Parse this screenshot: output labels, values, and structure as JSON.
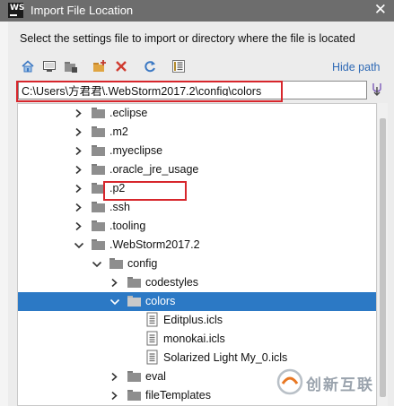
{
  "window": {
    "title": "Import File Location",
    "app_icon_text": "WS",
    "close_glyph": "✕"
  },
  "description": "Select the settings file to import or directory where the file is located",
  "toolbar": {
    "buttons": [
      "home-icon",
      "desktop-icon",
      "project-folder-icon",
      "new-folder-icon",
      "delete-icon",
      "refresh-icon",
      "show-hidden-icon"
    ],
    "hide_path_label": "Hide path"
  },
  "path": {
    "value": "C:\\Users\\方君君\\.WebStorm2017.2\\config\\colors"
  },
  "tree": {
    "rows": [
      {
        "label": ".eclipse",
        "kind": "folder",
        "arrow": "collapsed"
      },
      {
        "label": ".m2",
        "kind": "folder",
        "arrow": "collapsed"
      },
      {
        "label": ".myeclipse",
        "kind": "folder",
        "arrow": "collapsed"
      },
      {
        "label": ".oracle_jre_usage",
        "kind": "folder",
        "arrow": "collapsed"
      },
      {
        "label": ".p2",
        "kind": "folder",
        "arrow": "collapsed"
      },
      {
        "label": ".ssh",
        "kind": "folder",
        "arrow": "collapsed"
      },
      {
        "label": ".tooling",
        "kind": "folder",
        "arrow": "collapsed"
      },
      {
        "label": ".WebStorm2017.2",
        "kind": "folder",
        "arrow": "expanded"
      },
      {
        "label": "config",
        "kind": "folder",
        "arrow": "expanded"
      },
      {
        "label": "codestyles",
        "kind": "folder",
        "arrow": "collapsed"
      },
      {
        "label": "colors",
        "kind": "folder",
        "arrow": "expanded",
        "selected": true
      },
      {
        "label": "Editplus.icls",
        "kind": "file",
        "arrow": "none"
      },
      {
        "label": "monokai.icls",
        "kind": "file",
        "arrow": "none"
      },
      {
        "label": "Solarized Light My_0.icls",
        "kind": "file",
        "arrow": "none"
      },
      {
        "label": "eval",
        "kind": "folder",
        "arrow": "collapsed"
      },
      {
        "label": "fileTemplates",
        "kind": "folder",
        "arrow": "collapsed"
      }
    ]
  },
  "watermark": {
    "text": "创新互联"
  },
  "colors": {
    "selection": "#2c79c5",
    "highlight_box": "#d7262c",
    "link": "#2e69b5",
    "folder": "#8e8e8e"
  }
}
